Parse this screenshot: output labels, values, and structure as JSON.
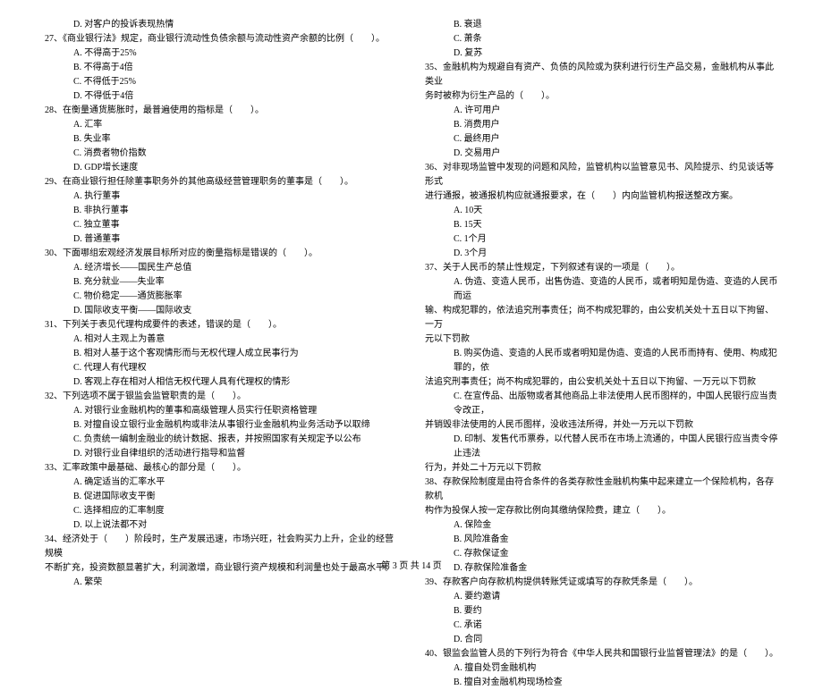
{
  "footer": "第 3 页 共 14 页",
  "left": {
    "pre_opt_d": "D. 对客户的投诉表现热情",
    "q27": {
      "stem": "27、《商业银行法》规定，商业银行流动性负债余额与流动性资产余额的比例（　　）。",
      "a": "A. 不得高于25%",
      "b": "B. 不得高于4倍",
      "c": "C. 不得低于25%",
      "d": "D. 不得低于4倍"
    },
    "q28": {
      "stem": "28、在衡量通货膨胀时，最普遍使用的指标是（　　）。",
      "a": "A. 汇率",
      "b": "B. 失业率",
      "c": "C. 消费者物价指数",
      "d": "D. GDP增长速度"
    },
    "q29": {
      "stem": "29、在商业银行担任除董事职务外的其他高级经营管理职务的董事是（　　）。",
      "a": "A. 执行董事",
      "b": "B. 非执行董事",
      "c": "C. 独立董事",
      "d": "D. 普通董事"
    },
    "q30": {
      "stem": "30、下面哪组宏观经济发展目标所对应的衡量指标是错误的（　　）。",
      "a": "A. 经济增长——国民生产总值",
      "b": "B. 充分就业——失业率",
      "c": "C. 物价稳定——通货膨胀率",
      "d": "D. 国际收支平衡——国际收支"
    },
    "q31": {
      "stem": "31、下列关于表见代理构成要件的表述，错误的是（　　）。",
      "a": "A. 相对人主观上为善意",
      "b": "B. 相对人基于这个客观情形而与无权代理人成立民事行为",
      "c": "C. 代理人有代理权",
      "d": "D. 客观上存在相对人相信无权代理人具有代理权的情形"
    },
    "q32": {
      "stem": "32、下列选项不属于银监会监管职责的是（　　）。",
      "a": "A. 对银行业金融机构的董事和高级管理人员实行任职资格管理",
      "b": "B. 对擅自设立银行业金融机构或非法从事银行业金融机构业务活动予以取缔",
      "c": "C. 负责统一编制金融业的统计数据、报表，并按照国家有关规定予以公布",
      "d": "D. 对银行业自律组织的活动进行指导和监督"
    },
    "q33": {
      "stem": "33、汇率政策中最基础、最核心的部分是（　　）。",
      "a": "A. 确定适当的汇率水平",
      "b": "B. 促进国际收支平衡",
      "c": "C. 选择相应的汇率制度",
      "d": "D. 以上说法都不对"
    },
    "q34": {
      "stem1": "34、经济处于（　　）阶段时，生产发展迅速，市场兴旺，社会购买力上升，企业的经营规模",
      "stem2": "不断扩充，投资数额显著扩大，利润激增，商业银行资产规模和利润量也处于最高水平。",
      "a": "A. 繁荣"
    }
  },
  "right": {
    "q34": {
      "b": "B. 衰退",
      "c": "C. 萧条",
      "d": "D. 复苏"
    },
    "q35": {
      "stem1": "35、金融机构为规避自有资产、负债的风险或为获利进行衍生产品交易，金融机构从事此类业",
      "stem2": "务时被称为衍生产品的（　　）。",
      "a": "A. 许可用户",
      "b": "B. 消费用户",
      "c": "C. 最终用户",
      "d": "D. 交易用户"
    },
    "q36": {
      "stem1": "36、对非现场监管中发现的问题和风险，监管机构以监管意见书、风险提示、约见谈话等形式",
      "stem2": "进行通报，被通报机构应就通报要求，在（　　）内向监管机构报送整改方案。",
      "a": "A. 10天",
      "b": "B. 15天",
      "c": "C. 1个月",
      "d": "D. 3个月"
    },
    "q37": {
      "stem": "37、关于人民币的禁止性规定，下列叙述有误的一项是（　　）。",
      "a1": "A. 伪造、变造人民币，出售伪造、变造的人民币，或者明知是伪造、变造的人民币而运",
      "a2": "输、构成犯罪的，依法追究刑事责任；尚不构成犯罪的，由公安机关处十五日以下拘留、一万",
      "a3": "元以下罚款",
      "b1": "B. 购买伪造、变造的人民币或者明知是伪造、变造的人民币而持有、使用、构成犯罪的，依",
      "b2": "法追究刑事责任；尚不构成犯罪的，由公安机关处十五日以下拘留、一万元以下罚款",
      "c1": "C. 在宣传品、出版物或者其他商品上非法使用人民币图样的，中国人民银行应当责令改正，",
      "c2": "并销毁非法使用的人民币图样，没收违法所得，并处一万元以下罚款",
      "d1": "D. 印制、发售代币票券，以代替人民币在市场上流通的，中国人民银行应当责令停止违法",
      "d2": "行为，并处二十万元以下罚款"
    },
    "q38": {
      "stem1": "38、存款保险制度是由符合条件的各类存款性金融机构集中起来建立一个保险机构，各存款机",
      "stem2": "构作为投保人按一定存款比例向其缴纳保险费，建立（　　）。",
      "a": "A. 保险金",
      "b": "B. 风险准备金",
      "c": "C. 存款保证金",
      "d": "D. 存款保险准备金"
    },
    "q39": {
      "stem": "39、存款客户向存款机构提供转账凭证或填写的存款凭条是（　　）。",
      "a": "A. 要约邀请",
      "b": "B. 要约",
      "c": "C. 承诺",
      "d": "D. 合同"
    },
    "q40": {
      "stem": "40、银监会监管人员的下列行为符合《中华人民共和国银行业监督管理法》的是（　　）。",
      "a": "A. 擅自处罚金融机构",
      "b": "B. 擅自对金融机构现场检查"
    }
  }
}
